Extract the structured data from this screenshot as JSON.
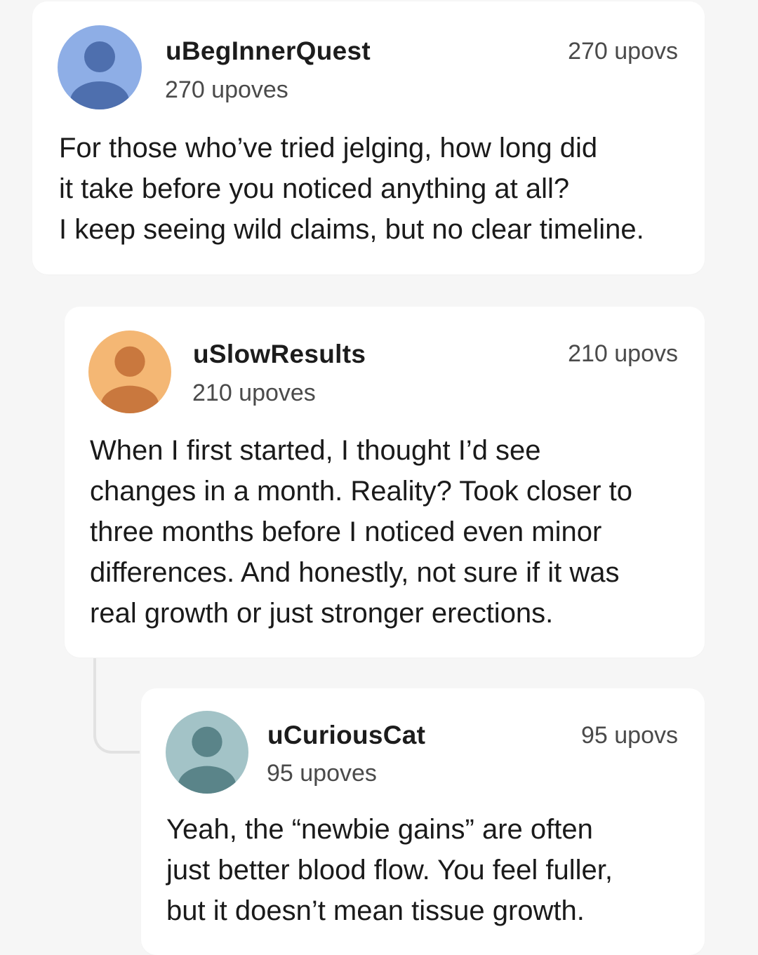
{
  "comments": [
    {
      "username": "uBegInnerQuest",
      "subscore": "270 upoves",
      "score": "270 upovs",
      "avatar_bg": "#8eaee6",
      "avatar_fg": "#4e6fae",
      "lines": [
        "For those who’ve tried jelging, how long did",
        "it take before you noticed anything at all?",
        "I keep seeing wild claims, but no clear timeline."
      ]
    },
    {
      "username": "uSlowResults",
      "subscore": "210 upoves",
      "score": "210 upovs",
      "avatar_bg": "#f4b774",
      "avatar_fg": "#c9783e",
      "lines": [
        "When I first started, I thought I’d see",
        "changes in a month. Reality? Took closer to",
        "three months before I noticed even minor",
        "differences. And honestly, not sure if it was",
        "real growth or just stronger erections."
      ]
    },
    {
      "username": "uCuriousCat",
      "subscore": "95 upoves",
      "score": "95 upovs",
      "avatar_bg": "#a3c3c7",
      "avatar_fg": "#5a8489",
      "lines": [
        "Yeah, the “newbie gains” are often",
        "just better blood flow. You feel fuller,",
        "but it doesn’t mean tissue growth."
      ]
    }
  ]
}
